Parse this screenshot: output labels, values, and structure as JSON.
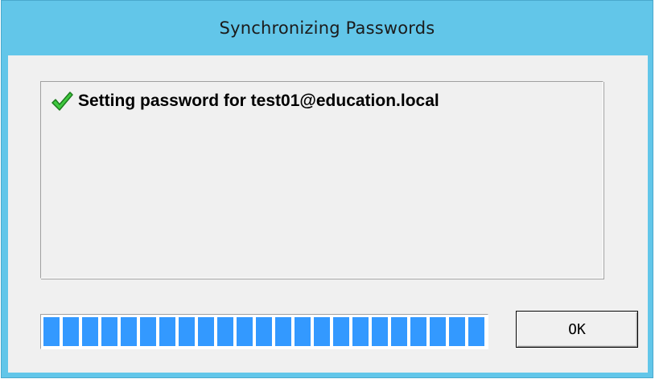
{
  "window": {
    "title": "Synchronizing Passwords"
  },
  "log": {
    "items": [
      {
        "icon": "check-icon",
        "icon_color": "#3fc93f",
        "text": "Setting password for test01@education.local"
      }
    ]
  },
  "progress": {
    "value_percent": 100,
    "fill_color": "#3399ff"
  },
  "buttons": {
    "ok_label": "OK"
  },
  "colors": {
    "titlebar": "#62c6e9",
    "client": "#f0f0f0"
  }
}
